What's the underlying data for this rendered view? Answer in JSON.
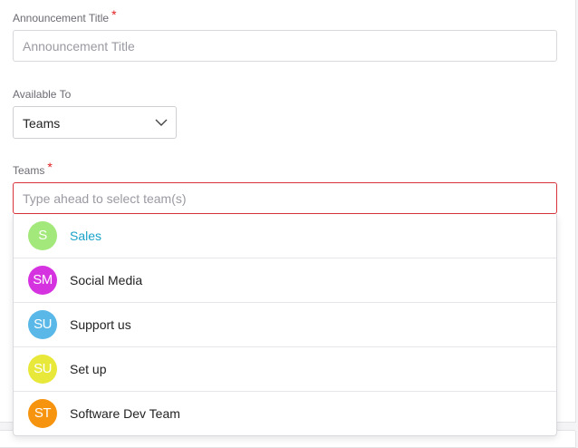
{
  "form": {
    "title_label": "Announcement Title",
    "title_required": "*",
    "title_placeholder": "Announcement Title",
    "available_label": "Available To",
    "available_value": "Teams",
    "teams_label": "Teams",
    "teams_required": "*",
    "teams_placeholder": "Type ahead to select team(s)"
  },
  "dropdown": {
    "options": [
      {
        "initials": "S",
        "label": "Sales",
        "color": "#a3e87a",
        "highlighted": true
      },
      {
        "initials": "SM",
        "label": "Social Media",
        "color": "#d633e0",
        "highlighted": false
      },
      {
        "initials": "SU",
        "label": "Support us",
        "color": "#5ab8e8",
        "highlighted": false
      },
      {
        "initials": "SU",
        "label": "Set up",
        "color": "#e8e83a",
        "highlighted": false
      },
      {
        "initials": "ST",
        "label": "Software Dev Team",
        "color": "#f7940f",
        "highlighted": false
      }
    ]
  },
  "colors": {
    "accent": "#1aa3c9",
    "error": "#d9343a",
    "required": "#e02020"
  }
}
